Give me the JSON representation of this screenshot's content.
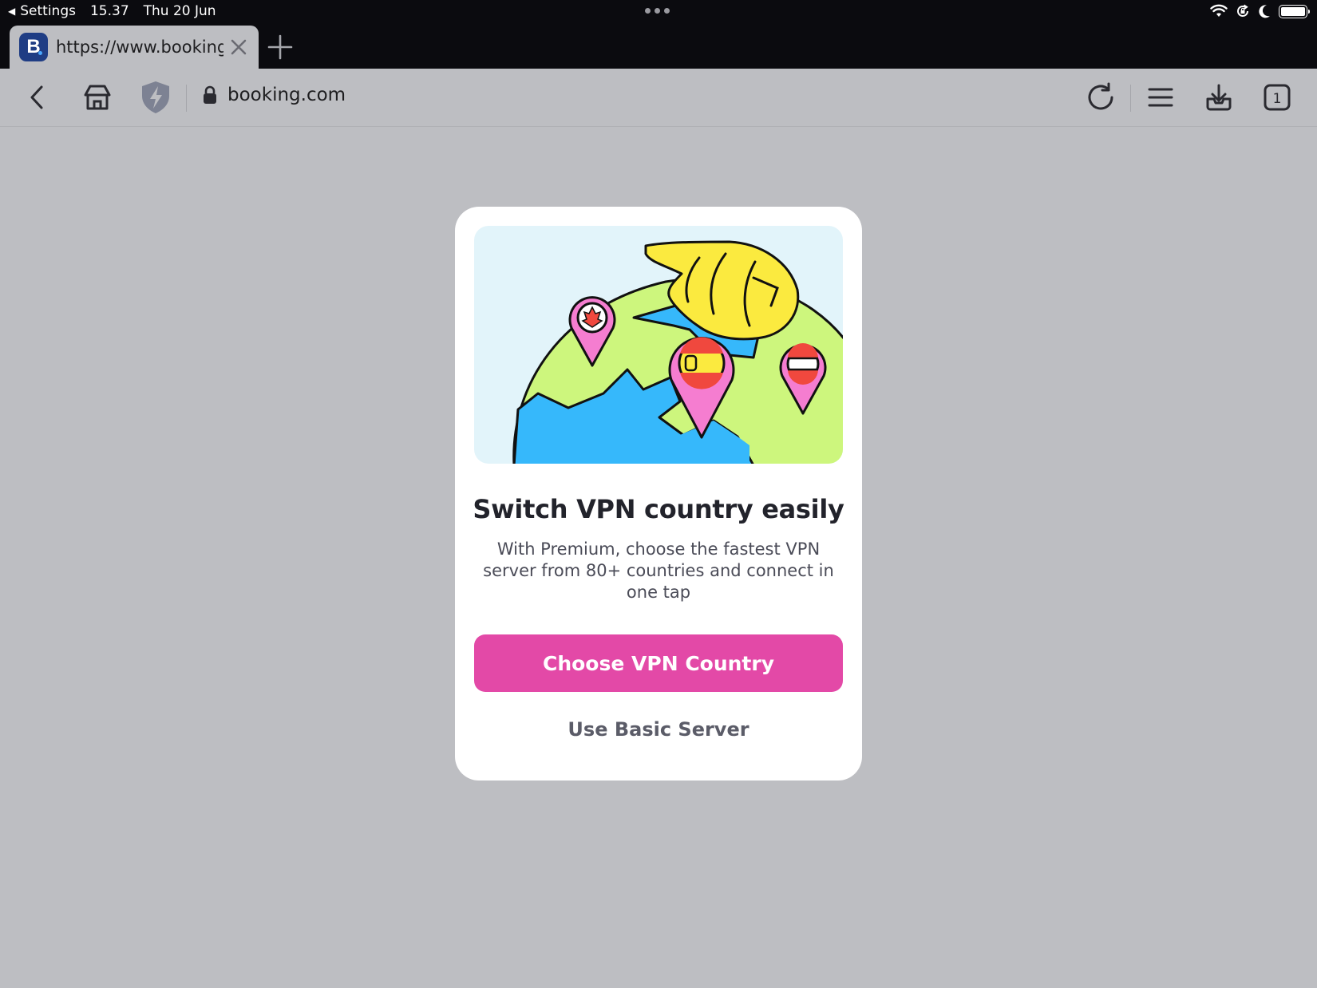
{
  "status_bar": {
    "back_app": "Settings",
    "time": "15.37",
    "date": "Thu 20 Jun"
  },
  "tab": {
    "favicon_letter": "B",
    "title": "https://www.booking...."
  },
  "toolbar": {
    "url": "booking.com",
    "tab_count": "1"
  },
  "modal": {
    "title": "Switch VPN country easily",
    "description": "With Premium, choose the fastest VPN server from 80+ countries and connect in one tap",
    "primary_button": "Choose VPN Country",
    "secondary_button": "Use Basic Server"
  },
  "colors": {
    "accent": "#e349a7",
    "page_bg": "#bdbec2",
    "chrome_bg": "#0b0b0f"
  }
}
